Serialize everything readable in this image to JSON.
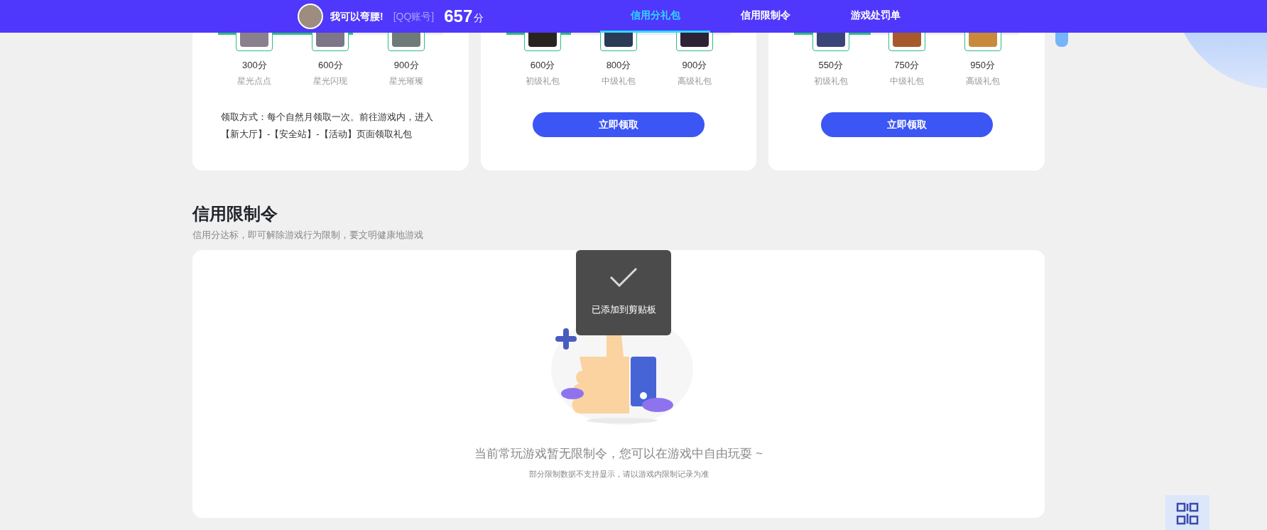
{
  "header": {
    "username": "我可以弯腰!",
    "account_label": "[QQ账号]",
    "score": "657",
    "score_unit": "分",
    "tabs": [
      {
        "label": "信用分礼包",
        "selected": true
      },
      {
        "label": "信用限制令",
        "selected": false
      },
      {
        "label": "游戏处罚单",
        "selected": false
      }
    ]
  },
  "gift_cards": [
    {
      "kind": "info",
      "level": 0.6,
      "tiers": [
        {
          "score": "300分",
          "label": "星光点点",
          "color": "#8a7f8c"
        },
        {
          "score": "600分",
          "label": "星光闪现",
          "color": "#7d7688"
        },
        {
          "score": "900分",
          "label": "星光璀璨",
          "color": "#6f7b78"
        }
      ],
      "text": "领取方式：每个自然月领取一次。前往游戏内，进入【新大厅】-【安全站】-【活动】页面领取礼包"
    },
    {
      "kind": "button",
      "level": 0.29,
      "tiers": [
        {
          "score": "600分",
          "label": "初级礼包",
          "color": "#2a2420"
        },
        {
          "score": "800分",
          "label": "中级礼包",
          "color": "#2b3a55"
        },
        {
          "score": "900分",
          "label": "高级礼包",
          "color": "#2d2236"
        }
      ],
      "text": "立即领取"
    },
    {
      "kind": "button",
      "level": 0.34,
      "tiers": [
        {
          "score": "550分",
          "label": "初级礼包",
          "color": "#3a4478"
        },
        {
          "score": "750分",
          "label": "中级礼包",
          "color": "#a65a2c"
        },
        {
          "score": "950分",
          "label": "高级礼包",
          "color": "#c9893a"
        }
      ],
      "text": "立即领取"
    }
  ],
  "restriction": {
    "title": "信用限制令",
    "subtitle": "信用分达标，即可解除游戏行为限制，要文明健康地游戏",
    "message": "当前常玩游戏暂无限制令，您可以在游戏中自由玩耍 ~",
    "note": "部分限制数据不支持显示，请以游戏内限制记录为准"
  },
  "toast": {
    "text": "已添加到剪贴板"
  }
}
